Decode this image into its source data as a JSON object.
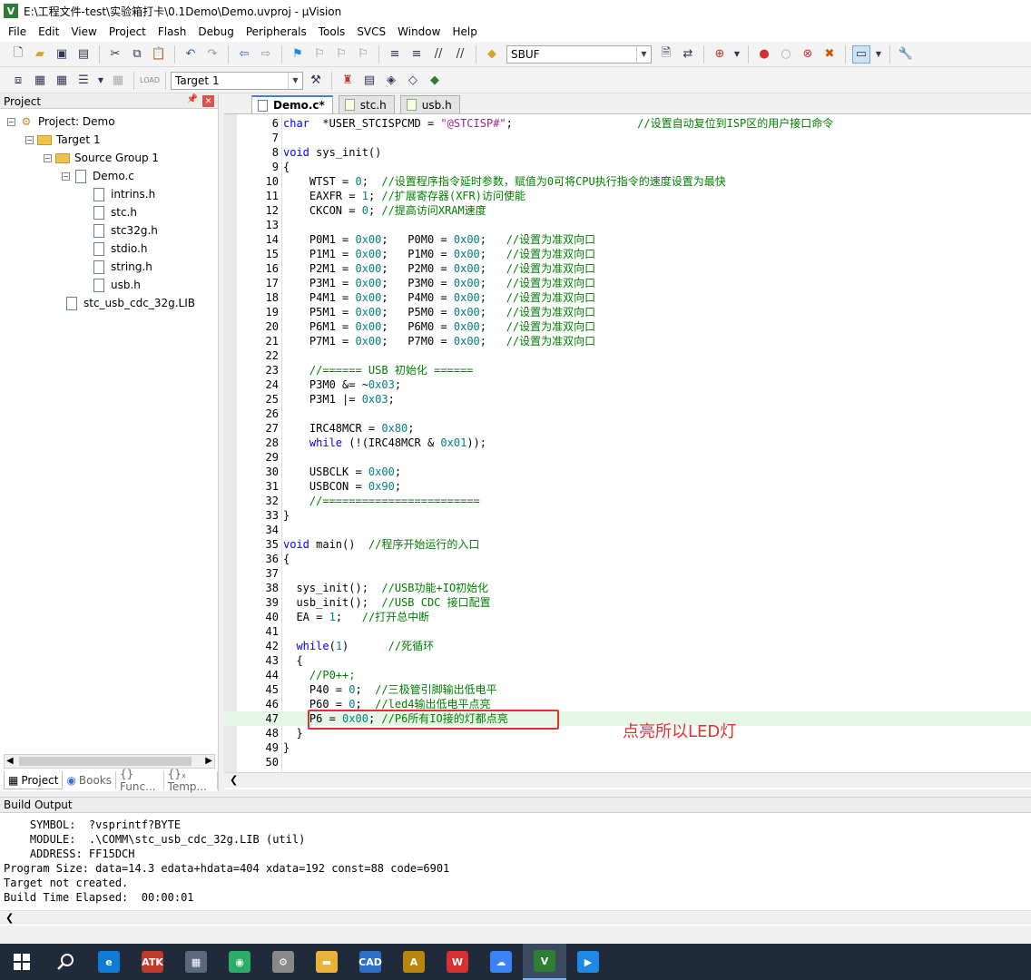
{
  "window": {
    "title": "E:\\工程文件-test\\实验箱打卡\\0.1Demo\\Demo.uvproj - µVision",
    "app_icon": "uvision-icon"
  },
  "menu": [
    "File",
    "Edit",
    "View",
    "Project",
    "Flash",
    "Debug",
    "Peripherals",
    "Tools",
    "SVCS",
    "Window",
    "Help"
  ],
  "toolbar": {
    "find_value": "SBUF",
    "target_value": "Target 1"
  },
  "project_panel": {
    "title": "Project",
    "tree": [
      {
        "label": "Project: Demo",
        "level": 0,
        "kind": "project",
        "expander": "−"
      },
      {
        "label": "Target 1",
        "level": 1,
        "kind": "target",
        "expander": "−"
      },
      {
        "label": "Source Group 1",
        "level": 2,
        "kind": "folder",
        "expander": "−"
      },
      {
        "label": "Demo.c",
        "level": 3,
        "kind": "file",
        "expander": "−"
      },
      {
        "label": "intrins.h",
        "level": 4,
        "kind": "file",
        "expander": ""
      },
      {
        "label": "stc.h",
        "level": 4,
        "kind": "file",
        "expander": ""
      },
      {
        "label": "stc32g.h",
        "level": 4,
        "kind": "file",
        "expander": ""
      },
      {
        "label": "stdio.h",
        "level": 4,
        "kind": "file",
        "expander": ""
      },
      {
        "label": "string.h",
        "level": 4,
        "kind": "file",
        "expander": ""
      },
      {
        "label": "usb.h",
        "level": 4,
        "kind": "file",
        "expander": ""
      },
      {
        "label": "stc_usb_cdc_32g.LIB",
        "level": 2.5,
        "kind": "file",
        "expander": ""
      }
    ],
    "tabs": [
      "Project",
      "Books",
      "{} Func...",
      "{}ₓ Temp..."
    ]
  },
  "editor": {
    "tabs": [
      {
        "label": "Demo.c*",
        "active": true
      },
      {
        "label": "stc.h",
        "active": false
      },
      {
        "label": "usb.h",
        "active": false
      }
    ],
    "highlighted_line": 47,
    "annotation": "点亮所以LED灯",
    "lines": [
      {
        "n": 6,
        "parts": [
          [
            "k",
            "char"
          ],
          [
            "",
            "  *USER_STCISPCMD = "
          ],
          [
            "s",
            "\"@STCISP#\""
          ],
          [
            "",
            ";                   "
          ],
          [
            "c",
            "//设置自动复位到ISP区的用户接口命令"
          ]
        ]
      },
      {
        "n": 7,
        "parts": []
      },
      {
        "n": 8,
        "parts": [
          [
            "k",
            "void"
          ],
          [
            "",
            " sys_init()"
          ]
        ]
      },
      {
        "n": 9,
        "parts": [
          [
            "",
            "{"
          ]
        ]
      },
      {
        "n": 10,
        "parts": [
          [
            "",
            "    WTST = "
          ],
          [
            "n",
            "0"
          ],
          [
            "",
            ";  "
          ],
          [
            "c",
            "//设置程序指令延时参数，赋值为0可将CPU执行指令的速度设置为最快"
          ]
        ]
      },
      {
        "n": 11,
        "parts": [
          [
            "",
            "    EAXFR = "
          ],
          [
            "n",
            "1"
          ],
          [
            "",
            "; "
          ],
          [
            "c",
            "//扩展寄存器(XFR)访问使能"
          ]
        ]
      },
      {
        "n": 12,
        "parts": [
          [
            "",
            "    CKCON = "
          ],
          [
            "n",
            "0"
          ],
          [
            "",
            "; "
          ],
          [
            "c",
            "//提高访问XRAM速度"
          ]
        ]
      },
      {
        "n": 13,
        "parts": []
      },
      {
        "n": 14,
        "parts": [
          [
            "",
            "    P0M1 = "
          ],
          [
            "n",
            "0x00"
          ],
          [
            "",
            ";   P0M0 = "
          ],
          [
            "n",
            "0x00"
          ],
          [
            "",
            ";   "
          ],
          [
            "c",
            "//设置为准双向口"
          ]
        ]
      },
      {
        "n": 15,
        "parts": [
          [
            "",
            "    P1M1 = "
          ],
          [
            "n",
            "0x00"
          ],
          [
            "",
            ";   P1M0 = "
          ],
          [
            "n",
            "0x00"
          ],
          [
            "",
            ";   "
          ],
          [
            "c",
            "//设置为准双向口"
          ]
        ]
      },
      {
        "n": 16,
        "parts": [
          [
            "",
            "    P2M1 = "
          ],
          [
            "n",
            "0x00"
          ],
          [
            "",
            ";   P2M0 = "
          ],
          [
            "n",
            "0x00"
          ],
          [
            "",
            ";   "
          ],
          [
            "c",
            "//设置为准双向口"
          ]
        ]
      },
      {
        "n": 17,
        "parts": [
          [
            "",
            "    P3M1 = "
          ],
          [
            "n",
            "0x00"
          ],
          [
            "",
            ";   P3M0 = "
          ],
          [
            "n",
            "0x00"
          ],
          [
            "",
            ";   "
          ],
          [
            "c",
            "//设置为准双向口"
          ]
        ]
      },
      {
        "n": 18,
        "parts": [
          [
            "",
            "    P4M1 = "
          ],
          [
            "n",
            "0x00"
          ],
          [
            "",
            ";   P4M0 = "
          ],
          [
            "n",
            "0x00"
          ],
          [
            "",
            ";   "
          ],
          [
            "c",
            "//设置为准双向口"
          ]
        ]
      },
      {
        "n": 19,
        "parts": [
          [
            "",
            "    P5M1 = "
          ],
          [
            "n",
            "0x00"
          ],
          [
            "",
            ";   P5M0 = "
          ],
          [
            "n",
            "0x00"
          ],
          [
            "",
            ";   "
          ],
          [
            "c",
            "//设置为准双向口"
          ]
        ]
      },
      {
        "n": 20,
        "parts": [
          [
            "",
            "    P6M1 = "
          ],
          [
            "n",
            "0x00"
          ],
          [
            "",
            ";   P6M0 = "
          ],
          [
            "n",
            "0x00"
          ],
          [
            "",
            ";   "
          ],
          [
            "c",
            "//设置为准双向口"
          ]
        ]
      },
      {
        "n": 21,
        "parts": [
          [
            "",
            "    P7M1 = "
          ],
          [
            "n",
            "0x00"
          ],
          [
            "",
            ";   P7M0 = "
          ],
          [
            "n",
            "0x00"
          ],
          [
            "",
            ";   "
          ],
          [
            "c",
            "//设置为准双向口"
          ]
        ]
      },
      {
        "n": 22,
        "parts": []
      },
      {
        "n": 23,
        "parts": [
          [
            "c",
            "    //====== USB 初始化 ======"
          ]
        ]
      },
      {
        "n": 24,
        "parts": [
          [
            "",
            "    P3M0 &= ~"
          ],
          [
            "n",
            "0x03"
          ],
          [
            "",
            ";"
          ]
        ]
      },
      {
        "n": 25,
        "parts": [
          [
            "",
            "    P3M1 |= "
          ],
          [
            "n",
            "0x03"
          ],
          [
            "",
            ";"
          ]
        ]
      },
      {
        "n": 26,
        "parts": []
      },
      {
        "n": 27,
        "parts": [
          [
            "",
            "    IRC48MCR = "
          ],
          [
            "n",
            "0x80"
          ],
          [
            "",
            ";"
          ]
        ]
      },
      {
        "n": 28,
        "parts": [
          [
            "",
            "    "
          ],
          [
            "k",
            "while"
          ],
          [
            "",
            " (!(IRC48MCR & "
          ],
          [
            "n",
            "0x01"
          ],
          [
            "",
            "));"
          ]
        ]
      },
      {
        "n": 29,
        "parts": []
      },
      {
        "n": 30,
        "parts": [
          [
            "",
            "    USBCLK = "
          ],
          [
            "n",
            "0x00"
          ],
          [
            "",
            ";"
          ]
        ]
      },
      {
        "n": 31,
        "parts": [
          [
            "",
            "    USBCON = "
          ],
          [
            "n",
            "0x90"
          ],
          [
            "",
            ";"
          ]
        ]
      },
      {
        "n": 32,
        "parts": [
          [
            "c",
            "    //========================"
          ]
        ]
      },
      {
        "n": 33,
        "parts": [
          [
            "",
            "}"
          ]
        ]
      },
      {
        "n": 34,
        "parts": []
      },
      {
        "n": 35,
        "parts": [
          [
            "k",
            "void"
          ],
          [
            "",
            " main()  "
          ],
          [
            "c",
            "//程序开始运行的入口"
          ]
        ]
      },
      {
        "n": 36,
        "parts": [
          [
            "",
            "{"
          ]
        ]
      },
      {
        "n": 37,
        "parts": []
      },
      {
        "n": 38,
        "parts": [
          [
            "",
            "  sys_init();  "
          ],
          [
            "c",
            "//USB功能+IO初始化"
          ]
        ]
      },
      {
        "n": 39,
        "parts": [
          [
            "",
            "  usb_init();  "
          ],
          [
            "c",
            "//USB CDC 接口配置"
          ]
        ]
      },
      {
        "n": 40,
        "parts": [
          [
            "",
            "  EA = "
          ],
          [
            "n",
            "1"
          ],
          [
            "",
            ";   "
          ],
          [
            "c",
            "//打开总中断"
          ]
        ]
      },
      {
        "n": 41,
        "parts": []
      },
      {
        "n": 42,
        "parts": [
          [
            "",
            "  "
          ],
          [
            "k",
            "while"
          ],
          [
            "",
            "("
          ],
          [
            "n",
            "1"
          ],
          [
            "",
            ")      "
          ],
          [
            "c",
            "//死循环"
          ]
        ]
      },
      {
        "n": 43,
        "parts": [
          [
            "",
            "  {"
          ]
        ]
      },
      {
        "n": 44,
        "parts": [
          [
            "c",
            "    //P0++;"
          ]
        ]
      },
      {
        "n": 45,
        "parts": [
          [
            "",
            "    P40 = "
          ],
          [
            "n",
            "0"
          ],
          [
            "",
            ";  "
          ],
          [
            "c",
            "//三极管引脚输出低电平"
          ]
        ]
      },
      {
        "n": 46,
        "parts": [
          [
            "",
            "    P60 = "
          ],
          [
            "n",
            "0"
          ],
          [
            "",
            ";  "
          ],
          [
            "c",
            "//led4输出低电平点亮"
          ]
        ]
      },
      {
        "n": 47,
        "parts": [
          [
            "",
            "    P6 = "
          ],
          [
            "n",
            "0x00"
          ],
          [
            "",
            "; "
          ],
          [
            "c",
            "//P6所有IO接的灯都点亮"
          ]
        ]
      },
      {
        "n": 48,
        "parts": [
          [
            "",
            "  }"
          ]
        ]
      },
      {
        "n": 49,
        "parts": [
          [
            "",
            "}"
          ]
        ]
      },
      {
        "n": 50,
        "parts": []
      }
    ]
  },
  "build_output": {
    "title": "Build Output",
    "lines": [
      "    SYMBOL:  ?vsprintf?BYTE",
      "    MODULE:  .\\COMM\\stc_usb_cdc_32g.LIB (util)",
      "    ADDRESS: FF15DCH",
      "Program Size: data=14.3 edata+hdata=404 xdata=192 const=88 code=6901",
      "Target not created.",
      "Build Time Elapsed:  00:00:01"
    ]
  },
  "taskbar": [
    {
      "icon": "windows-start-icon",
      "label": "",
      "color": "#1f2a3a"
    },
    {
      "icon": "search-icon",
      "label": "",
      "color": "#1f2a3a"
    },
    {
      "icon": "edge-browser-icon",
      "label": "e",
      "color": "#0f7bd4"
    },
    {
      "icon": "atk-xcom-icon",
      "label": "ATK",
      "color": "#c0392b"
    },
    {
      "icon": "calculator-icon",
      "label": "▦",
      "color": "#5b6b7f"
    },
    {
      "icon": "wechat-icon",
      "label": "◉",
      "color": "#2aae67"
    },
    {
      "icon": "tool-app-icon",
      "label": "⚙",
      "color": "#888888"
    },
    {
      "icon": "file-explorer-icon",
      "label": "▬",
      "color": "#e8b23a"
    },
    {
      "icon": "cad-icon",
      "label": "CAD",
      "color": "#2e6fcb"
    },
    {
      "icon": "app-a3-icon",
      "label": "A",
      "color": "#b8860b"
    },
    {
      "icon": "wps-icon",
      "label": "W",
      "color": "#d63031"
    },
    {
      "icon": "cloud-sync-icon",
      "label": "☁",
      "color": "#3b82f6"
    },
    {
      "icon": "uvision-icon",
      "label": "V",
      "color": "#2e7d32"
    },
    {
      "icon": "media-player-icon",
      "label": "▶",
      "color": "#1e88e5"
    }
  ]
}
